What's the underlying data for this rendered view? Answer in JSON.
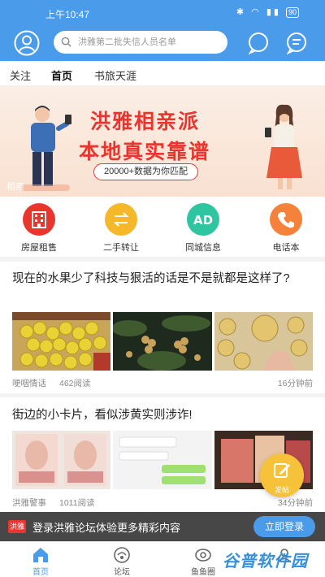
{
  "status_bar": {
    "time": "上午10:47",
    "battery": "90"
  },
  "header": {
    "search_placeholder": "洪雅第二批失信人员名单"
  },
  "tabs": [
    {
      "label": "关注"
    },
    {
      "label": "首页"
    },
    {
      "label": "书旅天涯"
    }
  ],
  "banner": {
    "title_line1": "洪雅相亲派",
    "title_line2": "本地真实靠谱",
    "subtitle": "20000+数据为你匹配",
    "tag": "相亲"
  },
  "quick_links": [
    {
      "label": "房屋租售",
      "icon": "building-icon",
      "color": "#e8362f"
    },
    {
      "label": "二手转让",
      "icon": "swap-arrows-icon",
      "color": "#f5b82a"
    },
    {
      "label": "同城信息",
      "icon": "ad-icon",
      "color": "#2ec5a0"
    },
    {
      "label": "电话本",
      "icon": "phone-icon",
      "color": "#f5823a"
    }
  ],
  "posts": [
    {
      "title": "现在的水果少了科技与狠活的话是不是就都是这样了?",
      "author": "哽咽情话",
      "reads": "462阅读",
      "time_ago": "16分钟前"
    },
    {
      "title": "街边的小卡片，看似涉黄实则涉诈!",
      "author": "洪雅警事",
      "reads": "1011阅读",
      "time_ago": "34分钟前"
    }
  ],
  "fab": {
    "label": "发帖"
  },
  "login_bar": {
    "logo_text": "洪雅",
    "text": "登录洪雅论坛体验更多精彩内容",
    "button": "立即登录"
  },
  "bottom_nav": [
    {
      "label": "首页"
    },
    {
      "label": "论坛"
    },
    {
      "label": "鱼鱼圈"
    },
    {
      "label": ""
    }
  ],
  "watermark": "谷普软件园",
  "colors": {
    "primary": "#4a9bea",
    "accent_red": "#e8362f"
  }
}
